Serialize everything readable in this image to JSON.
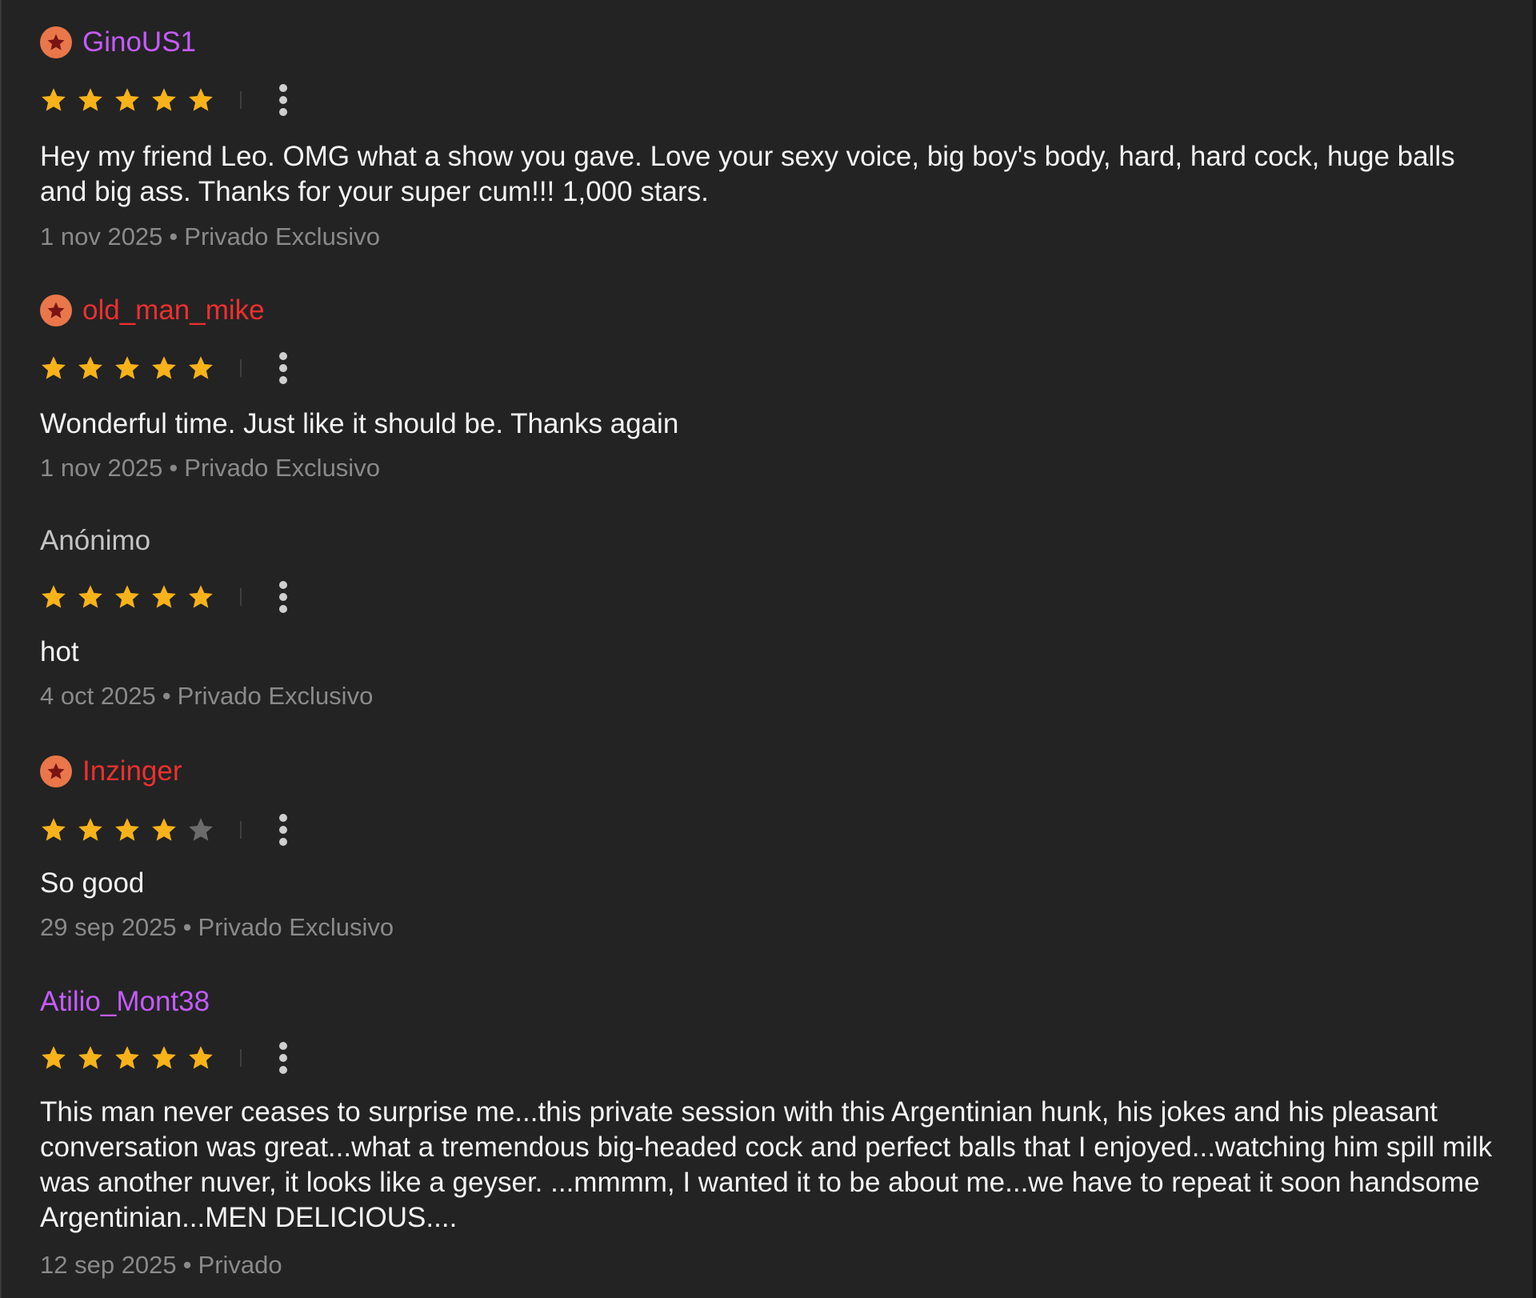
{
  "colors": {
    "background": "#232323",
    "star_filled": "#f8b21a",
    "star_empty": "#6b6b6b",
    "badge": "#e9774a",
    "badge_star": "#7a1414",
    "meta_text": "#8a8a8a",
    "purple_user": "#c55bff",
    "red_user": "#ef2f2f",
    "anon_user": "#c4c4c4"
  },
  "icons": {
    "badge": "star-badge-icon",
    "rating": "star-icon",
    "menu": "kebab-menu-icon"
  },
  "reviews": [
    {
      "username": "GinoUS1",
      "user_color": "#c55bff",
      "badge": true,
      "rating": 5,
      "text": "Hey my friend Leo. OMG what a show you gave. Love your sexy voice, big boy's body, hard, hard cock, huge balls and big ass. Thanks for your super cum!!! 1,000 stars.",
      "date": "1 nov 2025",
      "separator": "•",
      "type": "Privado Exclusivo"
    },
    {
      "username": "old_man_mike",
      "user_color": "#ef2f2f",
      "badge": true,
      "rating": 5,
      "text": "Wonderful time. Just like it should be. Thanks again",
      "date": "1 nov 2025",
      "separator": "•",
      "type": "Privado Exclusivo"
    },
    {
      "username": "Anónimo",
      "user_color": "#c4c4c4",
      "badge": false,
      "rating": 5,
      "text": "hot",
      "date": "4 oct 2025",
      "separator": "•",
      "type": "Privado Exclusivo"
    },
    {
      "username": "Inzinger",
      "user_color": "#ef2f2f",
      "badge": true,
      "rating": 4,
      "text": "So good",
      "date": "29 sep 2025",
      "separator": "•",
      "type": "Privado Exclusivo"
    },
    {
      "username": "Atilio_Mont38",
      "user_color": "#c55bff",
      "badge": false,
      "rating": 5,
      "text": "This man never ceases to surprise me...this private session with this Argentinian hunk, his jokes and his pleasant conversation was great...what a tremendous big-headed cock and perfect balls that I enjoyed...watching him spill milk was another nuver, it looks like a geyser. ...mmmm, I wanted it to be about me...we have to repeat it soon handsome Argentinian...MEN DELICIOUS....",
      "date": "12 sep 2025",
      "separator": "•",
      "type": "Privado"
    }
  ]
}
